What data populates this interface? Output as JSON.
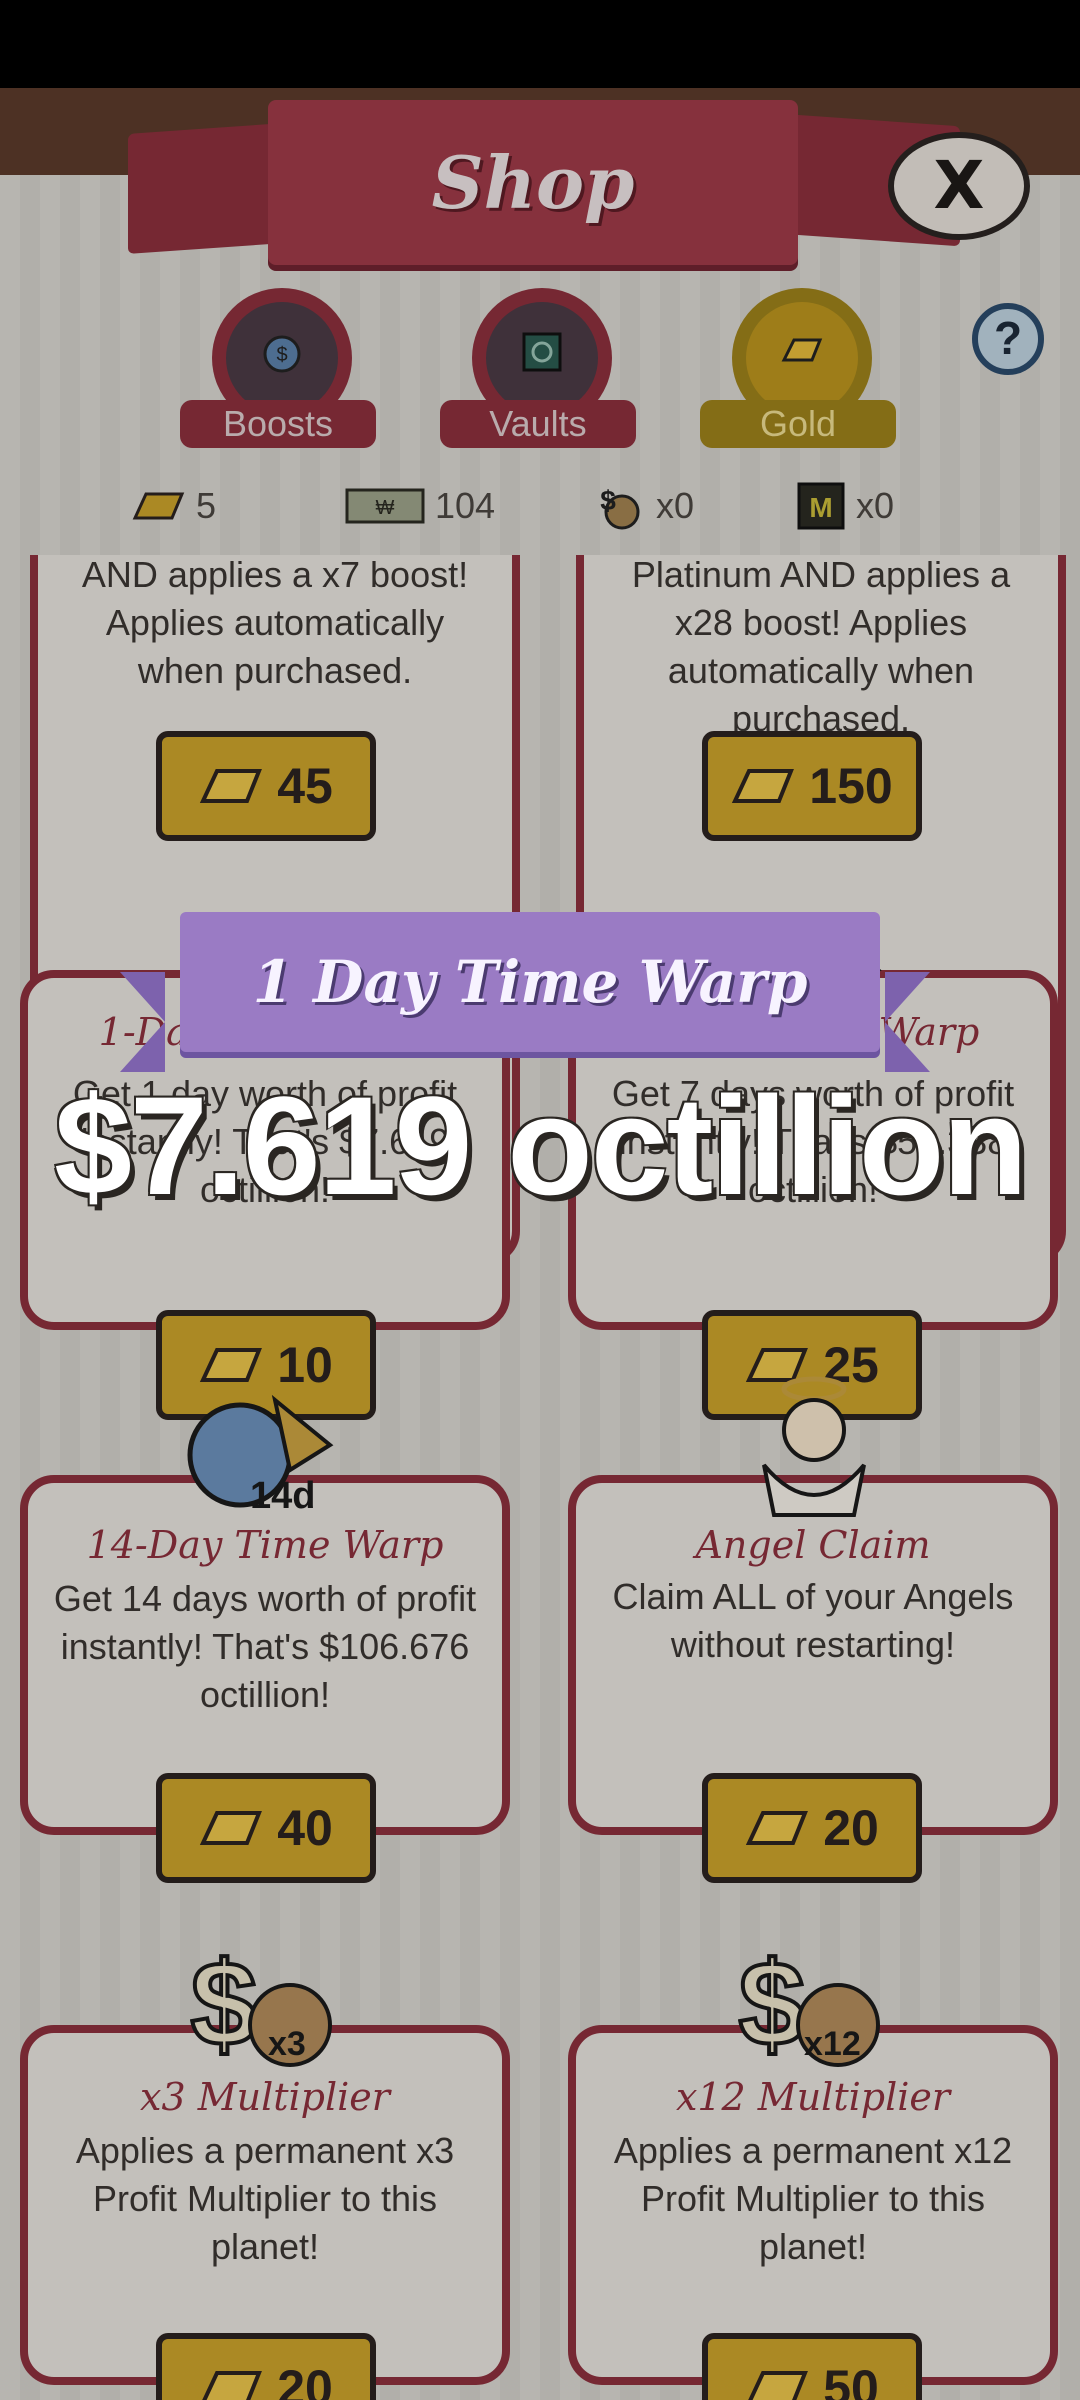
{
  "header": {
    "title": "Shop",
    "close_label": "X"
  },
  "tabs": [
    {
      "label": "Boosts",
      "icon": "boost-clock-icon"
    },
    {
      "label": "Vaults",
      "icon": "vault-safe-icon"
    },
    {
      "label": "Gold",
      "icon": "gold-bar-icon",
      "selected": true
    }
  ],
  "help_label": "?",
  "currencies": [
    {
      "icon": "gold-bar-icon",
      "value": "5"
    },
    {
      "icon": "megabucks-bill-icon",
      "value": "104"
    },
    {
      "icon": "money-bag-icon",
      "value": "x0"
    },
    {
      "icon": "mega-ticket-icon",
      "value": "x0"
    }
  ],
  "cards": [
    {
      "title": "",
      "desc": "AND applies a x7 boost! Applies automatically when purchased.",
      "price": "45"
    },
    {
      "title": "",
      "desc": "Platinum AND applies a x28 boost! Applies automatically when purchased.",
      "price": "150"
    },
    {
      "title": "1-Day Time Warp",
      "desc": "Get 1 day worth of profit instantly! That's $7.619 octillion!",
      "price": "10"
    },
    {
      "title": "7-Day Time Warp",
      "desc": "Get 7 days worth of profit instantly! That's $53.338 octillion!",
      "price": "25"
    },
    {
      "title": "14-Day Time Warp",
      "desc": "Get 14 days worth of profit instantly! That's $106.676 octillion!",
      "price": "40",
      "badge": "14d"
    },
    {
      "title": "Angel Claim",
      "desc": "Claim ALL of your Angels without restarting!",
      "price": "20"
    },
    {
      "title": "x3 Multiplier",
      "desc": "Applies a permanent x3 Profit Multiplier to this planet!",
      "price": "20",
      "badge": "x3"
    },
    {
      "title": "x12 Multiplier",
      "desc": "Applies a permanent x12 Profit Multiplier to this planet!",
      "price": "50",
      "badge": "x12"
    }
  ],
  "overlay": {
    "ribbon_text": "1 Day Time Warp",
    "reward_text": "$7.619 octillion"
  },
  "colors": {
    "accent": "#8a2f3c",
    "gold": "#c8a02a",
    "ribbon": "#9a7bc4"
  }
}
